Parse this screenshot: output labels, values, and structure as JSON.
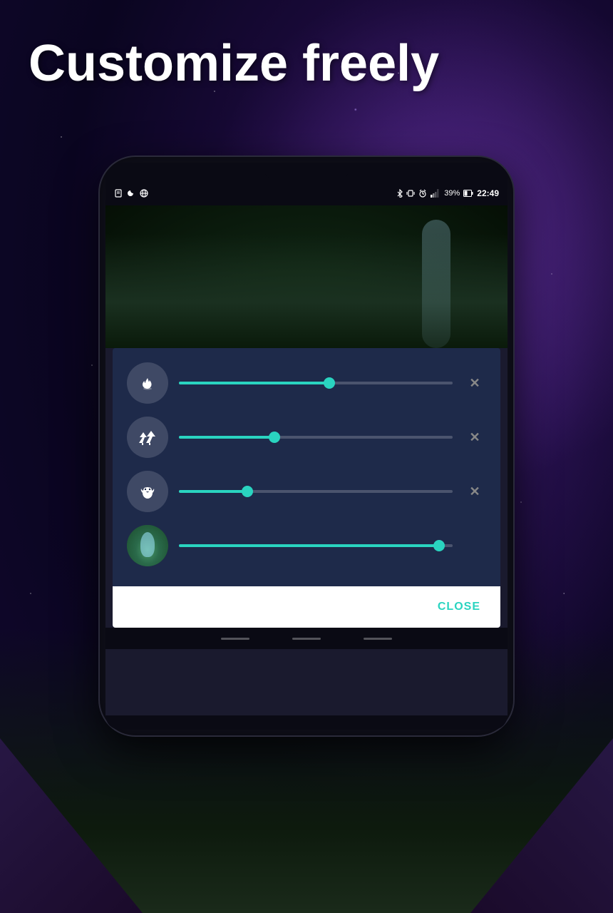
{
  "heading": {
    "title": "Customize freely"
  },
  "statusBar": {
    "time": "22:49",
    "battery": "39%",
    "icons": [
      "notification",
      "moon",
      "globe",
      "bluetooth",
      "vibrate",
      "alarm",
      "signal"
    ]
  },
  "dialog": {
    "sounds": [
      {
        "id": "campfire",
        "name": "Campfire",
        "icon": "🔥",
        "iconType": "symbol",
        "sliderValue": 55,
        "removable": true
      },
      {
        "id": "forest",
        "name": "Forest",
        "icon": "🌲",
        "iconType": "symbol",
        "sliderValue": 35,
        "removable": true
      },
      {
        "id": "owl",
        "name": "Owl",
        "icon": "🦉",
        "iconType": "symbol",
        "sliderValue": 25,
        "removable": true
      },
      {
        "id": "waterfall",
        "name": "Waterfall",
        "icon": "waterfall",
        "iconType": "photo",
        "sliderValue": 95,
        "removable": false
      }
    ],
    "closeButton": "CLOSE"
  },
  "bottomNav": [
    {
      "id": "back",
      "symbol": "◁"
    },
    {
      "id": "home",
      "symbol": "○"
    },
    {
      "id": "recent",
      "symbol": "□"
    }
  ],
  "colors": {
    "accent": "#2ad4c0",
    "panelBg": "#1e2a4a",
    "removeX": "#888888",
    "closeBtnColor": "#2ad4c0"
  }
}
